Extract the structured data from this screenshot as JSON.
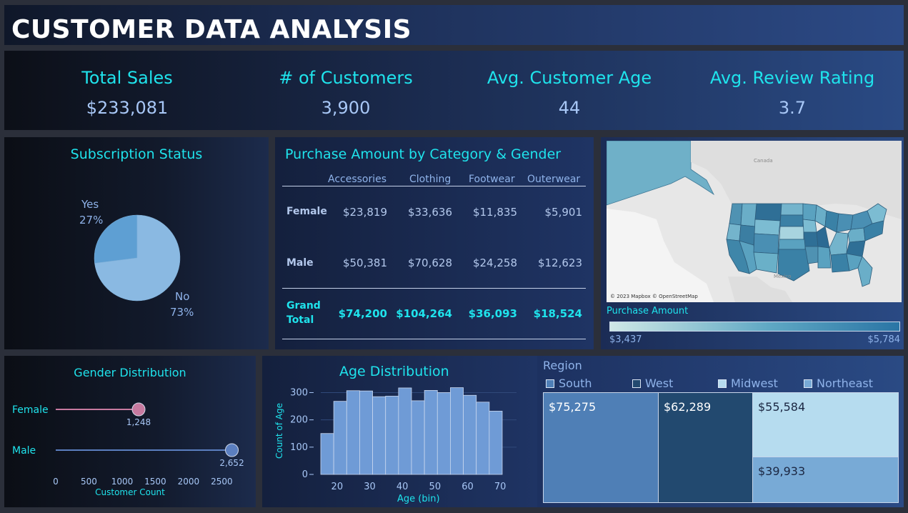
{
  "title": "CUSTOMER DATA ANALYSIS",
  "kpis": [
    {
      "label": "Total Sales",
      "value": "$233,081"
    },
    {
      "label": "# of Customers",
      "value": "3,900"
    },
    {
      "label": "Avg. Customer Age",
      "value": "44"
    },
    {
      "label": "Avg. Review Rating",
      "value": "3.7"
    }
  ],
  "subscription": {
    "title": "Subscription Status",
    "yes_label": "Yes",
    "yes_pct": "27%",
    "no_label": "No",
    "no_pct": "73%",
    "colors": {
      "yes": "#5e9fd3",
      "no": "#8ab9e2"
    }
  },
  "category": {
    "title": "Purchase Amount by Category & Gender",
    "columns": [
      "Accessories",
      "Clothing",
      "Footwear",
      "Outerwear"
    ],
    "rows": [
      {
        "label": "Female",
        "values": [
          "$23,819",
          "$33,636",
          "$11,835",
          "$5,901"
        ]
      },
      {
        "label": "Male",
        "values": [
          "$50,381",
          "$70,628",
          "$24,258",
          "$12,623"
        ]
      }
    ],
    "total_label_1": "Grand",
    "total_label_2": "Total",
    "totals": [
      "$74,200",
      "$104,264",
      "$36,093",
      "$18,524"
    ]
  },
  "map": {
    "attribution": "© 2023 Mapbox © OpenStreetMap",
    "label_canada": "Canada",
    "label_mexico": "Mexico",
    "legend_title": "Purchase Amount",
    "legend_min": "$3,437",
    "legend_max": "$5,784"
  },
  "gender": {
    "title": "Gender Distribution",
    "axis_title": "Customer Count",
    "ticks": [
      "0",
      "500",
      "1000",
      "1500",
      "2000",
      "2500"
    ],
    "items": [
      {
        "label": "Female",
        "count": 1248,
        "display": "1,248",
        "color": "#c77aa0"
      },
      {
        "label": "Male",
        "count": 2652,
        "display": "2,652",
        "color": "#5b7fc0"
      }
    ]
  },
  "age": {
    "title": "Age Distribution",
    "xlabel": "Age (bin)",
    "ylabel": "Count of Age",
    "xticks": [
      "20",
      "30",
      "40",
      "50",
      "60",
      "70"
    ],
    "yticks": [
      "0",
      "100",
      "200",
      "300"
    ]
  },
  "region": {
    "title": "Region",
    "legend": [
      {
        "label": "South",
        "color": "#4f7fb6"
      },
      {
        "label": "West",
        "color": "#22496f"
      },
      {
        "label": "Midwest",
        "color": "#b6dcef"
      },
      {
        "label": "Northeast",
        "color": "#78aad6"
      }
    ],
    "tiles": [
      {
        "label": "$75,275",
        "color": "#4f7fb6"
      },
      {
        "label": "$62,289",
        "color": "#22496f"
      },
      {
        "label": "$55,584",
        "color": "#b6dcef"
      },
      {
        "label": "$39,933",
        "color": "#78aad6"
      }
    ]
  },
  "chart_data": [
    {
      "type": "pie",
      "title": "Subscription Status",
      "categories": [
        "Yes",
        "No"
      ],
      "values": [
        27,
        73
      ]
    },
    {
      "type": "bar",
      "title": "Gender Distribution",
      "categories": [
        "Female",
        "Male"
      ],
      "values": [
        1248,
        2652
      ],
      "xlabel": "Customer Count",
      "xlim": [
        0,
        2700
      ]
    },
    {
      "type": "bar",
      "title": "Age Distribution",
      "x": [
        17.5,
        22.5,
        27.5,
        32.5,
        37.5,
        42.5,
        47.5,
        52.5,
        57.5,
        62.5,
        67.5,
        72.5
      ],
      "categories": [
        "15-20",
        "20-25",
        "25-30",
        "30-35",
        "35-40",
        "40-45",
        "45-50",
        "50-55",
        "55-60",
        "60-65",
        "65-70",
        "70-75"
      ],
      "values": [
        150,
        268,
        307,
        306,
        285,
        287,
        317,
        270,
        308,
        300,
        318,
        290,
        265,
        232
      ],
      "xlabel": "Age (bin)",
      "ylabel": "Count of Age",
      "ylim": [
        0,
        330
      ],
      "xlim": [
        15,
        75
      ]
    },
    {
      "type": "bar",
      "title": "Region",
      "categories": [
        "South",
        "West",
        "Midwest",
        "Northeast"
      ],
      "values": [
        75275,
        62289,
        55584,
        39933
      ]
    }
  ]
}
